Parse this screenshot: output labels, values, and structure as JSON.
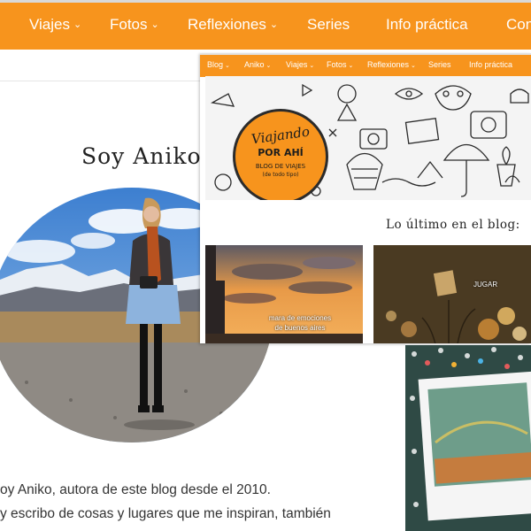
{
  "colors": {
    "brand_orange": "#f7941d"
  },
  "back_page": {
    "nav": [
      {
        "label": "Viajes",
        "dropdown": true
      },
      {
        "label": "Fotos",
        "dropdown": true
      },
      {
        "label": "Reflexiones",
        "dropdown": true
      },
      {
        "label": "Series",
        "dropdown": false
      },
      {
        "label": "Info práctica",
        "dropdown": false
      },
      {
        "label": "Con",
        "dropdown": false
      }
    ],
    "title": "Soy Aniko",
    "bio_lines": [
      "oy Aniko, autora de este blog desde el 2010.",
      "y escribo de cosas y lugares que me inspiran, también"
    ]
  },
  "blog_window": {
    "nav": [
      {
        "label": "Blog",
        "dropdown": true
      },
      {
        "label": "Aniko",
        "dropdown": true
      },
      {
        "label": "Viajes",
        "dropdown": true
      },
      {
        "label": "Fotos",
        "dropdown": true
      },
      {
        "label": "Reflexiones",
        "dropdown": true
      },
      {
        "label": "Series",
        "dropdown": false
      },
      {
        "label": "Info práctica",
        "dropdown": false
      }
    ],
    "logo": {
      "line1": "Viajando",
      "line2": "POR AHÍ",
      "line3": "BLOG DE VIAJES",
      "line4": "(de todo tipo)"
    },
    "latest_heading": "Lo último en el blog:",
    "cards": [
      {
        "caption_line1": "mara de emociones",
        "caption_line2": "de buenos aires"
      },
      {
        "caption_line1": "JUGAR"
      }
    ]
  }
}
